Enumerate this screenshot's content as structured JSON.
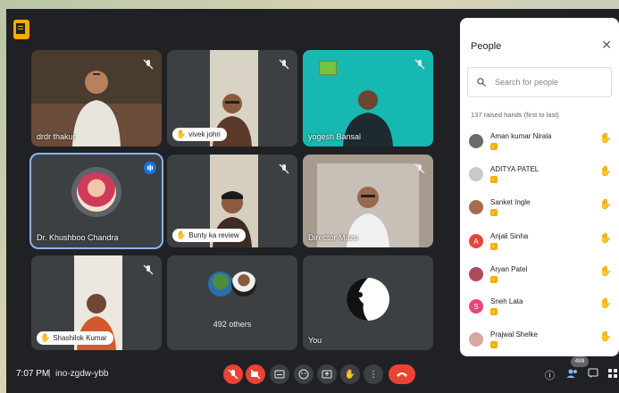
{
  "tiles": [
    {
      "name": "drdr thakur"
    },
    {
      "name": "vivek johri"
    },
    {
      "name": "yogesh Bansal"
    },
    {
      "name": "Dr. Khushboo Chandra"
    },
    {
      "name": "Bunty ka review"
    },
    {
      "name": "Director Mazu"
    },
    {
      "name": "Shashilok Kumar"
    },
    {
      "name": "492 others"
    },
    {
      "name": "You"
    }
  ],
  "panel": {
    "title": "People",
    "close_icon": "close-icon",
    "search_placeholder": "Search for people",
    "raised_label": "137 raised hands (first to last)",
    "people": [
      {
        "name": "Aman kumar Nirala",
        "initial": "",
        "color": "#6b6b6b"
      },
      {
        "name": "ADITYA PATEL",
        "initial": "",
        "color": "#c9c9c9"
      },
      {
        "name": "Sanket Ingle",
        "initial": "",
        "color": "#a96b4f"
      },
      {
        "name": "Anjali Sinha",
        "initial": "A",
        "color": "#e8453c"
      },
      {
        "name": "Aryan Patel",
        "initial": "",
        "color": "#b04a5a"
      },
      {
        "name": "Sneh Lata",
        "initial": "S",
        "color": "#e8457a"
      },
      {
        "name": "Prajwal Shelke",
        "initial": "",
        "color": "#d8a8a0"
      }
    ]
  },
  "bottom": {
    "time": "7:07 PM",
    "separator": "|",
    "meeting_code": "ino-zgdw-ybb",
    "participant_count": "499"
  },
  "colors": {
    "panel_bg": "#ffffff",
    "app_bg": "#202124",
    "accent_red": "#ea4335",
    "speaking_blue": "#1a73e8"
  }
}
